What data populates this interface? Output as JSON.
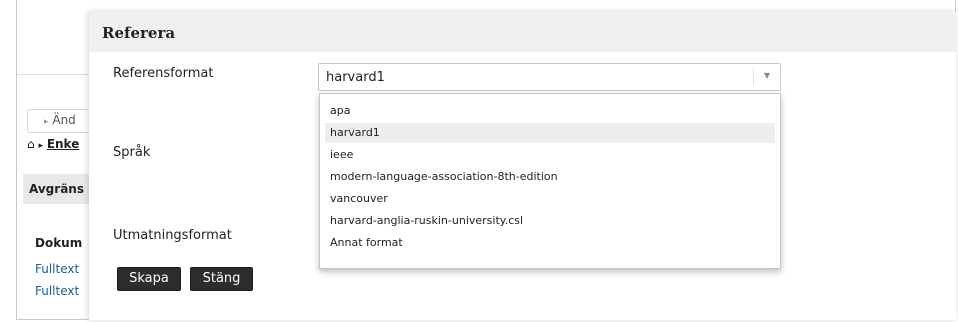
{
  "background_page": {
    "change_label": "Änd",
    "change_arrow": "▸",
    "breadcrumb_home_icon": "⌂",
    "breadcrumb_arrow": "▸",
    "breadcrumb_link": "Enke",
    "limit_heading": "Avgräns",
    "documents_heading": "Dokum",
    "links": [
      "Fulltext",
      "Fulltext"
    ]
  },
  "dialog": {
    "title": "Referera",
    "labels": {
      "reference_format": "Referensformat",
      "language": "Språk",
      "output_format": "Utmatningsformat"
    },
    "reference_format_select": {
      "value": "harvard1",
      "arrow_icon": "▼",
      "options": [
        "apa",
        "harvard1",
        "ieee",
        "modern-language-association-8th-edition",
        "vancouver",
        "harvard-anglia-ruskin-university.csl",
        "Annat format"
      ],
      "selected_index": 1
    },
    "buttons": {
      "create": "Skapa",
      "close": "Stäng"
    }
  }
}
